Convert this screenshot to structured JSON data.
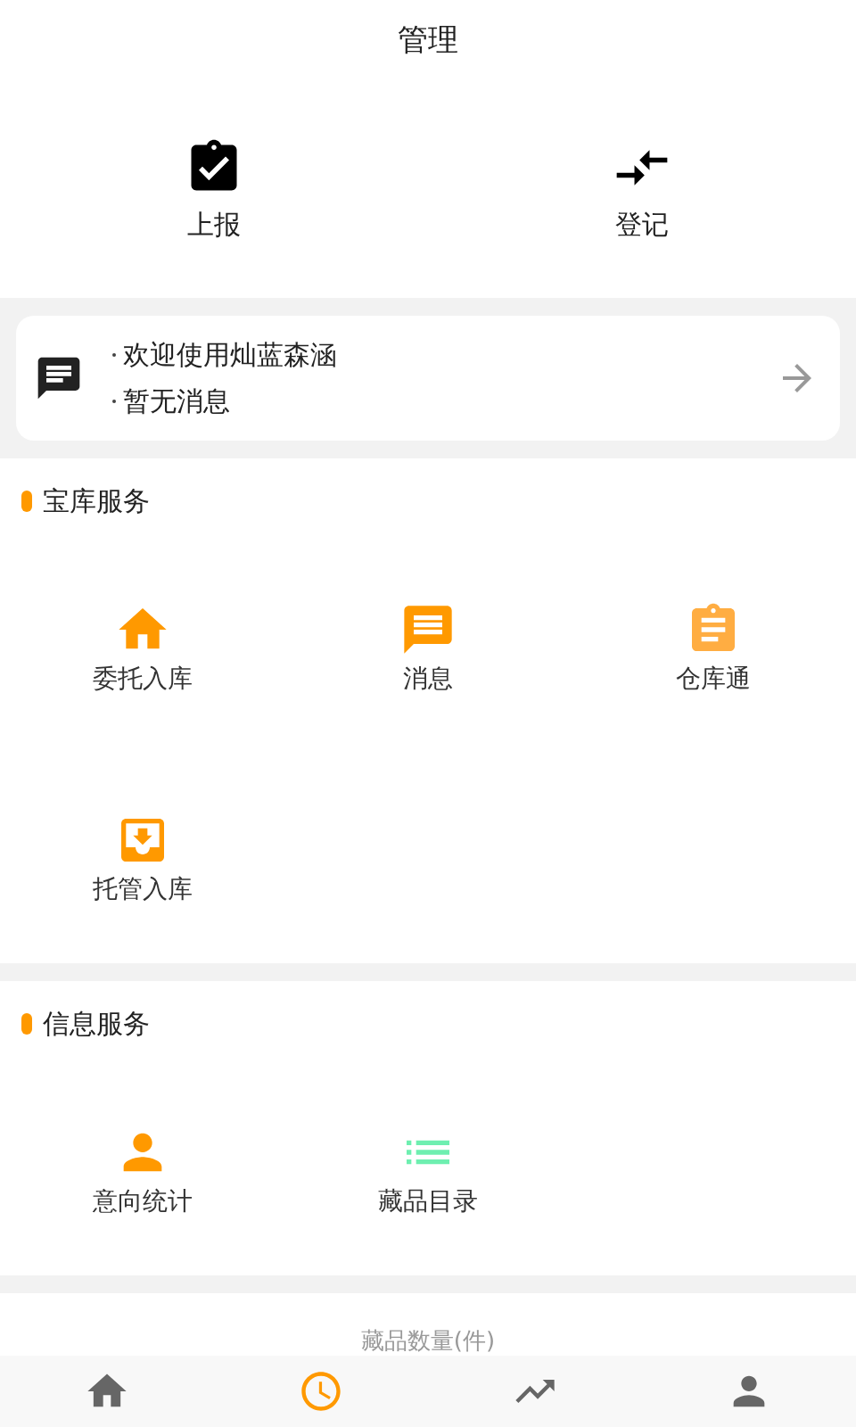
{
  "header": {
    "title": "管理"
  },
  "actions": [
    {
      "label": "上报"
    },
    {
      "label": "登记"
    }
  ],
  "notice": {
    "lines": [
      "欢迎使用灿蓝森涵",
      "暂无消息"
    ]
  },
  "sections": [
    {
      "title": "宝库服务",
      "items": [
        {
          "label": "委托入库"
        },
        {
          "label": "消息"
        },
        {
          "label": "仓库通"
        },
        {
          "label": "托管入库"
        }
      ]
    },
    {
      "title": "信息服务",
      "items": [
        {
          "label": "意向统计"
        },
        {
          "label": "藏品目录"
        }
      ]
    }
  ],
  "stats": {
    "title": "藏品数量(件)"
  },
  "tab_bar": [
    {
      "selected": false
    },
    {
      "selected": true
    },
    {
      "selected": false
    },
    {
      "selected": false
    }
  ]
}
